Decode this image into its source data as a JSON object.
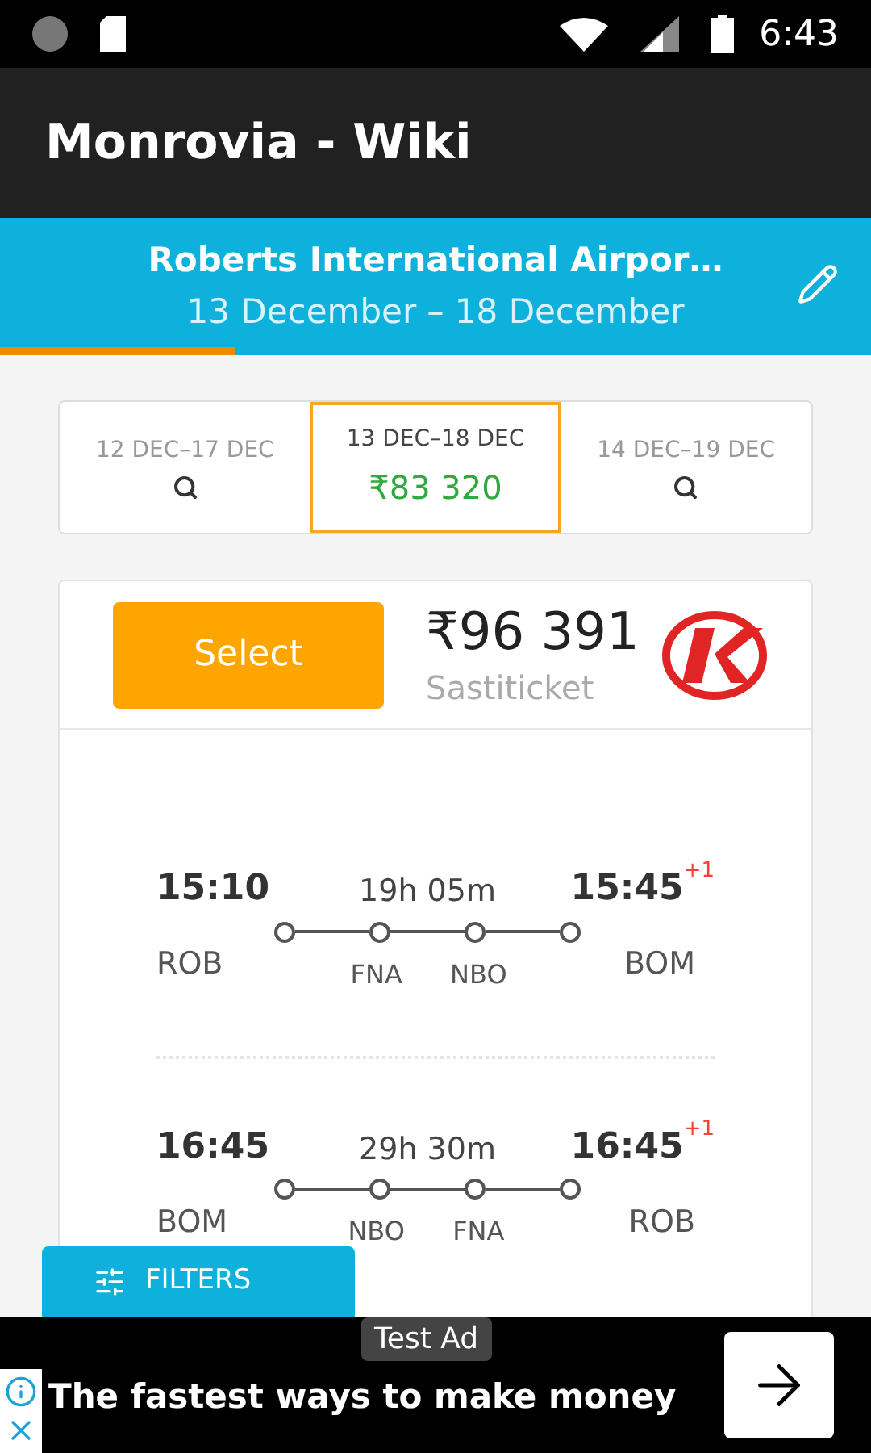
{
  "status_bar": {
    "time": "6:43"
  },
  "app_bar": {
    "title": "Monrovia - Wiki"
  },
  "header": {
    "title": "Roberts International Airpor…",
    "dates": "13 December – 18 December",
    "progress": {
      "level": 0.27
    }
  },
  "date_tabs": [
    {
      "label": "12 DEC–17 DEC",
      "selected": false
    },
    {
      "label": "13 DEC–18 DEC",
      "selected": true,
      "price": "₹83 320"
    },
    {
      "label": "14 DEC–19 DEC",
      "selected": false
    }
  ],
  "offer": {
    "button": "Select",
    "price": "₹96 391",
    "agency": "Sastiticket",
    "flights": [
      {
        "depart_time": "15:10",
        "depart_code": "ROB",
        "duration": "19h 05m",
        "stops": [
          "FNA",
          "NBO"
        ],
        "arrive_time": "15:45",
        "day_offset": "+1",
        "arrive_code": "BOM"
      },
      {
        "depart_time": "16:45",
        "depart_code": "BOM",
        "duration": "29h 30m",
        "stops": [
          "NBO",
          "FNA"
        ],
        "arrive_time": "16:45",
        "day_offset": "+1",
        "arrive_code": "ROB"
      }
    ]
  },
  "filters_button": "FILTERS",
  "ad": {
    "badge": "Test Ad",
    "text": "The fastest ways to make money"
  }
}
